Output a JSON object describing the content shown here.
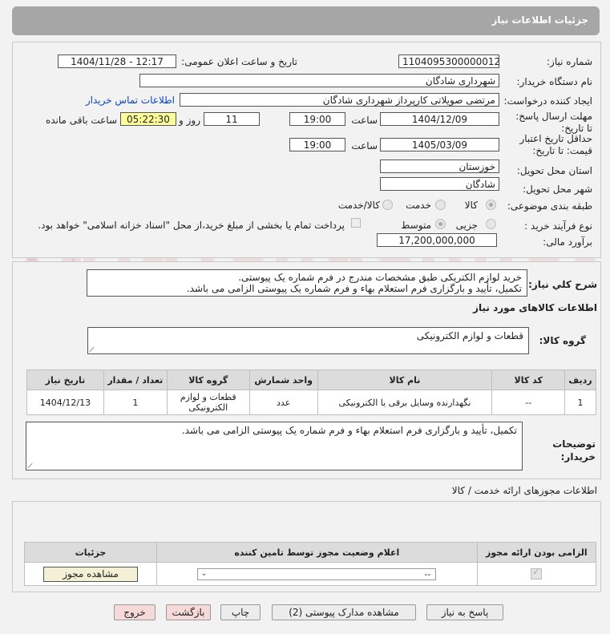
{
  "header": {
    "title": "جزئیات اطلاعات نیاز"
  },
  "form": {
    "need_number_label": "شماره نیاز:",
    "need_number": "1104095300000012",
    "announce_label": "تاریخ و ساعت اعلان عمومی:",
    "announce_value": "1404/11/28 - 12:17",
    "buyer_org_label": "نام دستگاه خریدار:",
    "buyer_org": "شهرداری شادگان",
    "creator_label": "ایجاد کننده درخواست:",
    "creator": "مرتضی صویلاتی کارپرداز شهرداری شادگان",
    "contact_link": "اطلاعات تماس خریدار",
    "reply_deadline_label": "مهلت ارسال پاسخ: تا تاریخ:",
    "reply_date": "1404/12/09",
    "time_label": "ساعت",
    "reply_time": "19:00",
    "days": "11",
    "days_label": "روز و",
    "remaining_time": "05:22:30",
    "remaining_label": "ساعت باقی مانده",
    "price_validity_label": "حداقل تاریخ اعتبار قیمت: تا تاریخ:",
    "price_date": "1405/03/09",
    "price_time": "19:00",
    "province_label": "استان محل تحویل:",
    "province": "خوزستان",
    "city_label": "شهر محل تحویل:",
    "city": "شادگان",
    "category_label": "طبقه بندی موضوعی:",
    "category_options": [
      "کالا",
      "خدمت",
      "کالا/خدمت"
    ],
    "process_label": "نوع فرآیند خرید :",
    "process_options": [
      "جزیی",
      "متوسط"
    ],
    "payment_note": "پرداخت تمام یا بخشی از مبلغ خرید،از محل \"اسناد خزانه اسلامی\" خواهد بود.",
    "estimate_label": "برآورد مالی:",
    "estimate": "17,200,000,000"
  },
  "description": {
    "label": "شرح کلي نياز:",
    "text_line1": "خرید لوازم الکتریکی طبق مشخصات مندرج در فرم شماره یک پیوستی.",
    "text_line2": "تکمیل، تأیید و بارگزاری فرم استعلام بهاء و فرم شماره یک پیوستی الزامی می باشد."
  },
  "goods": {
    "section_title": "اطلاعات کالاهای مورد نیاز",
    "group_label": "گروه کالا:",
    "group_value": "قطعات و لوازم الکترونیکی",
    "table": {
      "headers": [
        "ردیف",
        "کد کالا",
        "نام کالا",
        "واحد شمارش",
        "گروه کالا",
        "تعداد / مقدار",
        "تاریخ نیاز"
      ],
      "rows": [
        [
          "1",
          "--",
          "نگهدارنده وسایل برقی یا الکترونیکی",
          "عدد",
          "قطعات و لوازم الکترونیکی",
          "1",
          "1404/12/13"
        ]
      ]
    },
    "buyer_notes_label": "توضیحات خریدار:",
    "buyer_notes": "تکمیل، تأیید و بارگزاری فرم استعلام بهاء و فرم شماره یک پیوستی الزامی می باشد."
  },
  "permits": {
    "section_title": "اطلاعات مجوزهای ارائه خدمت / کالا",
    "headers": [
      "الزامی بودن ارائه مجوز",
      "اعلام وضعیت مجوز توسط تامین کننده",
      "جزئیات"
    ],
    "select_value": "--",
    "view_button": "مشاهده مجوز"
  },
  "buttons": {
    "reply": "پاسخ به نیاز",
    "attachments": "مشاهده مدارک پیوستی (2)",
    "print": "چاپ",
    "back": "بازگشت",
    "exit": "خروج"
  }
}
